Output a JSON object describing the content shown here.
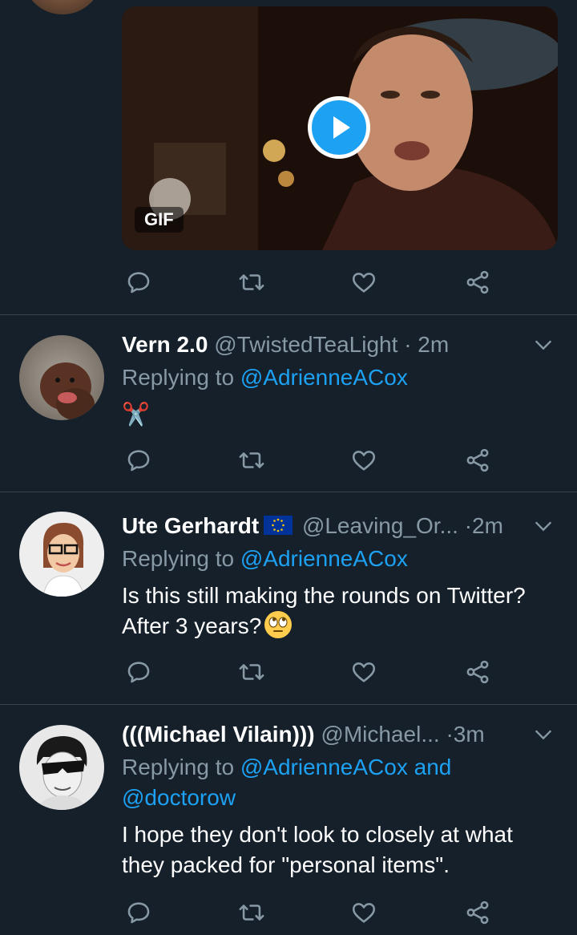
{
  "colors": {
    "background": "#15202b",
    "divider": "#38444d",
    "secondary_text": "#8899a6",
    "link": "#1da1f2"
  },
  "media": {
    "badge": "GIF",
    "play_icon": "play-icon"
  },
  "actions": {
    "icons": [
      "reply-icon",
      "retweet-icon",
      "like-icon",
      "share-icon"
    ]
  },
  "tweets": [
    {
      "name": "Vern 2.0",
      "handle": "@TwistedTeaLight",
      "separator": "·",
      "time": "2m",
      "replying_prefix": "Replying to ",
      "replying_to": "@AdrienneACox",
      "body": "✂️"
    },
    {
      "name": "Ute Gerhardt",
      "handle": "@Leaving_Or...",
      "separator": "·",
      "time": "2m",
      "replying_prefix": "Replying to ",
      "replying_to": "@AdrienneACox",
      "body_line1": "Is this still making the rounds on Twitter?",
      "body_line2": "After 3 years?",
      "emoji": "face-with-rolling-eyes"
    },
    {
      "name": "(((Michael Vilain)))",
      "handle": "@Michael...",
      "separator": "·",
      "time": "3m",
      "replying_prefix": "Replying to ",
      "replying_to": "@AdrienneACox and",
      "replying_to_2": "@doctorow",
      "body_line1": "I hope they don't look to closely at what",
      "body_line2": "they packed for \"personal items\"."
    }
  ]
}
